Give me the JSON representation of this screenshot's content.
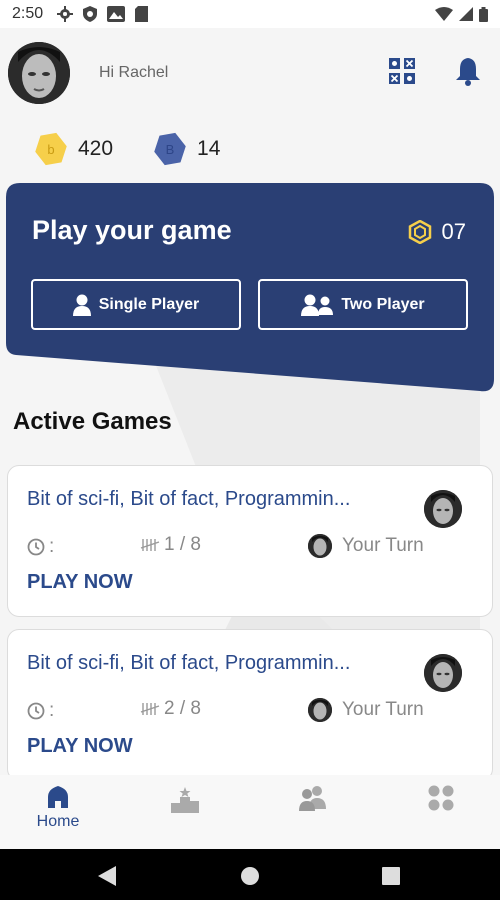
{
  "status_bar": {
    "time": "2:50"
  },
  "header": {
    "greeting": "Hi Rachel",
    "icons": [
      "qr-icon",
      "bell-icon"
    ]
  },
  "coins": [
    {
      "symbol": "b",
      "value": "420",
      "color": "#f6cf4a"
    },
    {
      "symbol": "B",
      "value": "14",
      "color": "#4a63a8"
    }
  ],
  "play_card": {
    "title": "Play your game",
    "count": "07",
    "single_label": "Single Player",
    "two_label": "Two Player"
  },
  "active_games": {
    "title": "Active Games",
    "games": [
      {
        "title": "Bit of sci-fi, Bit of fact, Programmin...",
        "clock_text": ":",
        "progress": "1 / 8",
        "turn": "Your Turn",
        "action": "PLAY NOW"
      },
      {
        "title": "Bit of sci-fi, Bit of fact, Programmin...",
        "clock_text": ":",
        "progress": "2 / 8",
        "turn": "Your Turn",
        "action": "PLAY NOW"
      }
    ]
  },
  "bottom_nav": {
    "items": [
      {
        "label": "Home",
        "icon": "home-icon",
        "active": true
      },
      {
        "label": "",
        "icon": "leaderboard-icon",
        "active": false
      },
      {
        "label": "",
        "icon": "friends-icon",
        "active": false
      },
      {
        "label": "",
        "icon": "apps-icon",
        "active": false
      }
    ]
  },
  "colors": {
    "primary": "#2b4a8b",
    "card_bg": "#2a3f74",
    "coin_gold": "#f6cf4a",
    "coin_blue": "#4a63a8",
    "background": "#f5f5f5"
  }
}
